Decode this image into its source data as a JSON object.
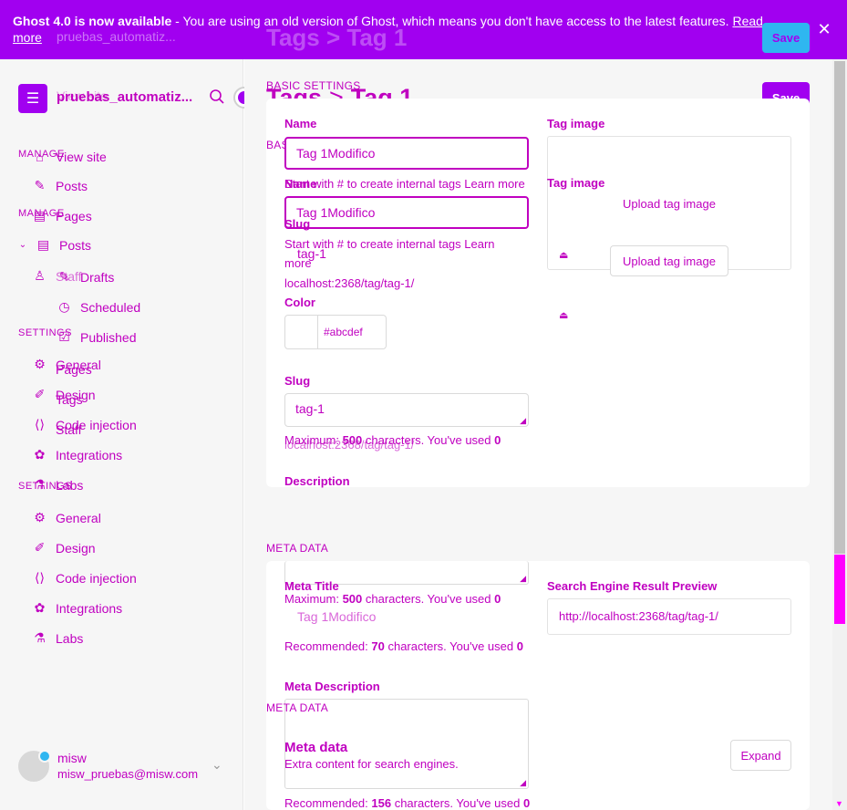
{
  "banner": {
    "strong": "Ghost 4.0 is now available",
    "text": " - You are using an old version of Ghost, which means you don't have access to the latest features. ",
    "link": "Read more",
    "ghost_site": "pruebas_automatiz...",
    "ghost_title": "Tags  >  Tag 1",
    "ghost_save": "Save"
  },
  "sidebar": {
    "site_name": "pruebas_automatiz...",
    "ghost_site_label": "View site",
    "sections": {
      "manage": "MANAGE",
      "settings": "SETTINGS"
    },
    "items": {
      "view_site": "View site",
      "posts": "Posts",
      "pages": "Pages",
      "tags": "Tags",
      "staff": "Staff",
      "drafts": "Drafts",
      "scheduled": "Scheduled",
      "published": "Published",
      "integrations": "Integrations",
      "labs": "Labs",
      "general": "General",
      "design": "Design",
      "code_injection": "Code injection"
    },
    "user": {
      "name": "misw",
      "email": "misw_pruebas@misw.com"
    }
  },
  "header": {
    "crumb_parent": "Tags",
    "crumb_current": "Tag 1",
    "save_label": "Save"
  },
  "basic": {
    "section": "BASIC SETTINGS",
    "name_label": "Name",
    "name_value": "Tag 1Modifico",
    "name_hint": "Start with # to create internal tags Learn more",
    "name_hint_a": "Start with # to create internal tags Learn",
    "name_hint_b": "more",
    "slug_label": "Slug",
    "slug_value": "tag-1",
    "slug_url": "localhost:2368/tag/tag-1/",
    "color_label": "Color",
    "color_placeholder": "#abcdef",
    "description_label": "Description",
    "description_hint_prefix": "Maximum: ",
    "description_max": "500",
    "description_hint_mid": " characters. You've used ",
    "description_used": "0",
    "tag_image_label": "Tag image",
    "upload_label": "Upload tag image"
  },
  "meta": {
    "section": "META DATA",
    "title_label": "Meta Title",
    "title_placeholder": "Tag 1Modifico",
    "title_hint_prefix": "Recommended: ",
    "title_max": "70",
    "title_hint_mid": " characters. You've used ",
    "title_used": "0",
    "description_label": "Meta Description",
    "desc_hint_prefix": "Recommended: ",
    "desc_max": "156",
    "desc_hint_mid": " characters. You've used ",
    "desc_used": "0",
    "preview_label": "Search Engine Result Preview",
    "preview_url": "http://localhost:2368/tag/tag-1/",
    "card_title": "Meta data",
    "card_subtitle": "Extra content for search engines.",
    "expand_label": "Expand"
  },
  "colors": {
    "accent": "#a100f0",
    "text": "#c000c0",
    "highlight": "#ff00ff"
  }
}
